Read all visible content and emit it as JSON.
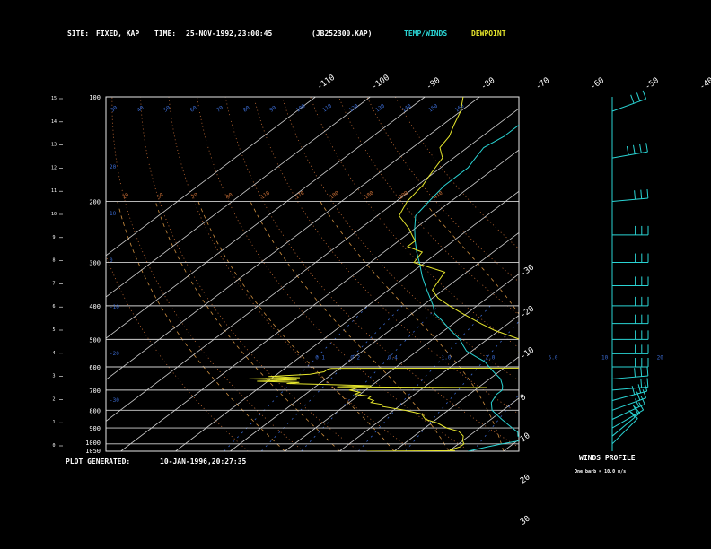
{
  "header": {
    "site_label": "SITE:",
    "site_value": "FIXED, KAP",
    "time_label": "TIME:",
    "time_value": "25-NOV-1992,23:00:45",
    "file": "(JB252300.KAP)",
    "legend_temp": "TEMP/WINDS",
    "legend_dew": "DEWPOINT"
  },
  "footer": {
    "generated_label": "PLOT GENERATED:",
    "generated_value": "10-JAN-1996,20:27:35"
  },
  "colors": {
    "background": "#000000",
    "text": "#ffffff",
    "temperature": "#2ad4d4",
    "dewpoint": "#e6e62c",
    "isotherm": "#d0d0d0",
    "isobar": "#d0d0d0",
    "dry_adiabat": "#c86e36",
    "moist_adiabat": "#d09040",
    "mixing_ratio": "#3a6ad0",
    "wind": "#2ad4d4"
  },
  "chart_data": [
    {
      "type": "line",
      "chart_kind": "skew-T log-P sounding",
      "pressure_levels": [
        100,
        200,
        300,
        400,
        500,
        600,
        700,
        800,
        900,
        1000,
        1050
      ],
      "height_labels": [
        "0",
        "1",
        "2",
        "3",
        "4",
        "5",
        "6",
        "7",
        "8",
        "9",
        "10",
        "11",
        "12",
        "13",
        "14",
        "15"
      ],
      "temperature_labels": [
        "-110",
        "-100",
        "-90",
        "-80",
        "-70",
        "-60",
        "-50",
        "-40",
        "-30",
        "-20",
        "-10",
        "0",
        "10",
        "20",
        "30"
      ],
      "mixing_ratio_labels": [
        "0.1",
        "0.2",
        "0.4",
        "1.0",
        "2.0",
        "5.0",
        "10",
        "20"
      ],
      "mixing_ratio_pressure": 550,
      "isotherms_c": [
        -110,
        -100,
        -90,
        -80,
        -70,
        -60,
        -50,
        -40,
        -30,
        -20,
        -10,
        0,
        10,
        20,
        30
      ],
      "dry_adiabats_c": [
        -40,
        -30,
        -20,
        -10,
        0,
        10,
        20,
        30,
        40,
        50,
        60,
        70
      ],
      "upper_theta_labels": [
        "30",
        "40",
        "50",
        "60",
        "70",
        "80",
        "90",
        "100",
        "110",
        "120",
        "130",
        "140",
        "150",
        "160"
      ],
      "upper_theta2_labels": [
        "20",
        "50",
        "70",
        "90",
        "110",
        "170",
        "180",
        "180",
        "200",
        "410"
      ],
      "series": [
        {
          "name": "TEMP/WINDS",
          "points": [
            [
              1050,
              3.5
            ],
            [
              1020,
              6
            ],
            [
              1000,
              8
            ],
            [
              975,
              11
            ],
            [
              950,
              9
            ],
            [
              925,
              8
            ],
            [
              900,
              6
            ],
            [
              850,
              2
            ],
            [
              800,
              -2
            ],
            [
              760,
              -4
            ],
            [
              720,
              -5
            ],
            [
              700,
              -5
            ],
            [
              680,
              -6
            ],
            [
              650,
              -8
            ],
            [
              620,
              -11
            ],
            [
              600,
              -13
            ],
            [
              580,
              -15
            ],
            [
              560,
              -18
            ],
            [
              540,
              -21
            ],
            [
              520,
              -23
            ],
            [
              500,
              -25
            ],
            [
              470,
              -29
            ],
            [
              440,
              -33
            ],
            [
              420,
              -36
            ],
            [
              400,
              -38
            ],
            [
              360,
              -43
            ],
            [
              330,
              -47
            ],
            [
              300,
              -51
            ],
            [
              280,
              -54
            ],
            [
              260,
              -57
            ],
            [
              240,
              -60
            ],
            [
              220,
              -63
            ],
            [
              200,
              -64
            ],
            [
              180,
              -65
            ],
            [
              160,
              -65
            ],
            [
              150,
              -66
            ],
            [
              140,
              -67
            ],
            [
              130,
              -66
            ],
            [
              120,
              -66
            ],
            [
              110,
              -66
            ],
            [
              100,
              -66
            ]
          ]
        },
        {
          "name": "DEWPOINT",
          "points": [
            [
              1050,
              -15
            ],
            [
              1046,
              1
            ],
            [
              1040,
              0
            ],
            [
              1020,
              1
            ],
            [
              1000,
              1
            ],
            [
              980,
              0
            ],
            [
              950,
              -1
            ],
            [
              920,
              -3
            ],
            [
              900,
              -6
            ],
            [
              870,
              -9
            ],
            [
              850,
              -12
            ],
            [
              820,
              -14
            ],
            [
              800,
              -18
            ],
            [
              780,
              -23
            ],
            [
              770,
              -23.5
            ],
            [
              760,
              -26
            ],
            [
              750,
              -26
            ],
            [
              740,
              -27.5
            ],
            [
              730,
              -27.5
            ],
            [
              720,
              -31
            ],
            [
              710,
              -30.5
            ],
            [
              700,
              -33
            ],
            [
              690,
              -32
            ],
            [
              688,
              -8.5
            ],
            [
              685,
              -36
            ],
            [
              680,
              -30
            ],
            [
              670,
              -46
            ],
            [
              665,
              -44
            ],
            [
              660,
              -52
            ],
            [
              655,
              -45
            ],
            [
              650,
              -54
            ],
            [
              645,
              -45
            ],
            [
              640,
              -51
            ],
            [
              630,
              -44
            ],
            [
              620,
              -42
            ],
            [
              610,
              -42
            ],
            [
              606,
              -41.5
            ],
            [
              605,
              -7
            ],
            [
              600,
              -6
            ],
            [
              590,
              -6
            ],
            [
              580,
              -6.5
            ],
            [
              570,
              -7.5
            ],
            [
              560,
              -9
            ],
            [
              545,
              -11
            ],
            [
              530,
              -11
            ],
            [
              520,
              -11
            ],
            [
              510,
              -13
            ],
            [
              500,
              -14
            ],
            [
              470,
              -21
            ],
            [
              450,
              -25
            ],
            [
              420,
              -31
            ],
            [
              400,
              -35
            ],
            [
              380,
              -39
            ],
            [
              360,
              -42
            ],
            [
              340,
              -43
            ],
            [
              320,
              -44
            ],
            [
              300,
              -52
            ],
            [
              280,
              -53
            ],
            [
              270,
              -57
            ],
            [
              260,
              -57
            ],
            [
              250,
              -59
            ],
            [
              240,
              -61
            ],
            [
              220,
              -66
            ],
            [
              200,
              -68
            ],
            [
              180,
              -69
            ],
            [
              170,
              -70
            ],
            [
              160,
              -71
            ],
            [
              150,
              -72
            ],
            [
              140,
              -75
            ],
            [
              130,
              -76
            ],
            [
              120,
              -78
            ],
            [
              110,
              -80
            ],
            [
              100,
              -83
            ]
          ]
        }
      ]
    },
    {
      "type": "wind barbs",
      "title": "WINDS PROFILE",
      "scale_note": "One barb = 10.0 m/s",
      "barbs": [
        {
          "p": 1000,
          "dir": 225,
          "spd": 10
        },
        {
          "p": 950,
          "dir": 230,
          "spd": 15
        },
        {
          "p": 900,
          "dir": 240,
          "spd": 20
        },
        {
          "p": 850,
          "dir": 245,
          "spd": 20
        },
        {
          "p": 800,
          "dir": 250,
          "spd": 20
        },
        {
          "p": 750,
          "dir": 255,
          "spd": 25
        },
        {
          "p": 700,
          "dir": 265,
          "spd": 20
        },
        {
          "p": 650,
          "dir": 265,
          "spd": 25
        },
        {
          "p": 600,
          "dir": 270,
          "spd": 25
        },
        {
          "p": 550,
          "dir": 270,
          "spd": 30
        },
        {
          "p": 500,
          "dir": 270,
          "spd": 25
        },
        {
          "p": 450,
          "dir": 270,
          "spd": 25
        },
        {
          "p": 400,
          "dir": 270,
          "spd": 30
        },
        {
          "p": 350,
          "dir": 270,
          "spd": 30
        },
        {
          "p": 300,
          "dir": 270,
          "spd": 25
        },
        {
          "p": 250,
          "dir": 270,
          "spd": 30
        },
        {
          "p": 200,
          "dir": 265,
          "spd": 30
        },
        {
          "p": 150,
          "dir": 260,
          "spd": 35
        },
        {
          "p": 110,
          "dir": 250,
          "spd": 25
        }
      ]
    }
  ]
}
